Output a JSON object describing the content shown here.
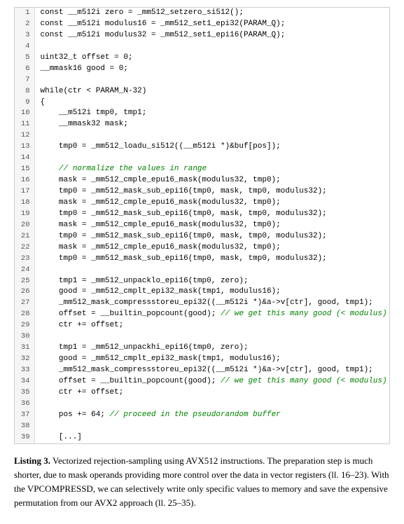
{
  "code": {
    "lines": [
      {
        "num": 1,
        "text": "const __m512i zero = _mm512_setzero_si512();",
        "type": "normal"
      },
      {
        "num": 2,
        "text": "const __m512i modulus16 = _mm512_set1_epi32(PARAM_Q);",
        "type": "normal"
      },
      {
        "num": 3,
        "text": "const __m512i modulus32 = _mm512_set1_epi16(PARAM_Q);",
        "type": "normal"
      },
      {
        "num": 4,
        "text": "",
        "type": "empty"
      },
      {
        "num": 5,
        "text": "uint32_t offset = 0;",
        "type": "normal"
      },
      {
        "num": 6,
        "text": "__mmask16 good = 0;",
        "type": "normal"
      },
      {
        "num": 7,
        "text": "",
        "type": "empty"
      },
      {
        "num": 8,
        "text": "while(ctr < PARAM_N-32)",
        "type": "normal"
      },
      {
        "num": 9,
        "text": "{",
        "type": "normal"
      },
      {
        "num": 10,
        "text": "    __m512i tmp0, tmp1;",
        "type": "normal"
      },
      {
        "num": 11,
        "text": "    __mmask32 mask;",
        "type": "normal"
      },
      {
        "num": 12,
        "text": "",
        "type": "empty"
      },
      {
        "num": 13,
        "text": "    tmp0 = _mm512_loadu_si512((__m512i *)&buf[pos]);",
        "type": "normal"
      },
      {
        "num": 14,
        "text": "",
        "type": "empty"
      },
      {
        "num": 15,
        "text": "    // normalize the values in range",
        "type": "comment"
      },
      {
        "num": 16,
        "text": "    mask = _mm512_cmple_epu16_mask(modulus32, tmp0);",
        "type": "normal"
      },
      {
        "num": 17,
        "text": "    tmp0 = _mm512_mask_sub_epi16(tmp0, mask, tmp0, modulus32);",
        "type": "normal"
      },
      {
        "num": 18,
        "text": "    mask = _mm512_cmple_epu16_mask(modulus32, tmp0);",
        "type": "normal"
      },
      {
        "num": 19,
        "text": "    tmp0 = _mm512_mask_sub_epi16(tmp0, mask, tmp0, modulus32);",
        "type": "normal"
      },
      {
        "num": 20,
        "text": "    mask = _mm512_cmple_epu16_mask(modulus32, tmp0);",
        "type": "normal"
      },
      {
        "num": 21,
        "text": "    tmp0 = _mm512_mask_sub_epi16(tmp0, mask, tmp0, modulus32);",
        "type": "normal"
      },
      {
        "num": 22,
        "text": "    mask = _mm512_cmple_epu16_mask(modulus32, tmp0);",
        "type": "normal"
      },
      {
        "num": 23,
        "text": "    tmp0 = _mm512_mask_sub_epi16(tmp0, mask, tmp0, modulus32);",
        "type": "normal"
      },
      {
        "num": 24,
        "text": "",
        "type": "empty"
      },
      {
        "num": 25,
        "text": "    tmp1 = _mm512_unpacklo_epi16(tmp0, zero);",
        "type": "normal"
      },
      {
        "num": 26,
        "text": "    good = _mm512_cmplt_epi32_mask(tmp1, modulus16);",
        "type": "normal"
      },
      {
        "num": 27,
        "text": "    _mm512_mask_compressstoreu_epi32((__m512i *)&a->v[ctr], good, tmp1);",
        "type": "normal"
      },
      {
        "num": 28,
        "text": "    offset = __builtin_popcount(good); // we get this many good (< modulus) values",
        "type": "comment_inline"
      },
      {
        "num": 29,
        "text": "    ctr += offset;",
        "type": "normal"
      },
      {
        "num": 30,
        "text": "",
        "type": "empty"
      },
      {
        "num": 31,
        "text": "    tmp1 = _mm512_unpackhi_epi16(tmp0, zero);",
        "type": "normal"
      },
      {
        "num": 32,
        "text": "    good = _mm512_cmplt_epi32_mask(tmp1, modulus16);",
        "type": "normal"
      },
      {
        "num": 33,
        "text": "    _mm512_mask_compressstoreu_epi32((__m512i *)&a->v[ctr], good, tmp1);",
        "type": "normal"
      },
      {
        "num": 34,
        "text": "    offset = __builtin_popcount(good); // we get this many good (< modulus) values",
        "type": "comment_inline"
      },
      {
        "num": 35,
        "text": "    ctr += offset;",
        "type": "normal"
      },
      {
        "num": 36,
        "text": "",
        "type": "empty"
      },
      {
        "num": 37,
        "text": "    pos += 64; // proceed in the pseudorandom buffer",
        "type": "comment_inline"
      },
      {
        "num": 38,
        "text": "",
        "type": "empty"
      },
      {
        "num": 39,
        "text": "    [...]",
        "type": "normal"
      }
    ]
  },
  "caption": {
    "label": "Listing 3.",
    "text": " Vectorized rejection-sampling using AVX512 instructions. The preparation step is much shorter, due to mask operands providing more control over the data in vector registers (ll. 16–23). With the VPCOMPRESSD, we can selectively write only specific values to memory and save the expensive permutation from our AVX2 approach (ll. 25–35)."
  }
}
